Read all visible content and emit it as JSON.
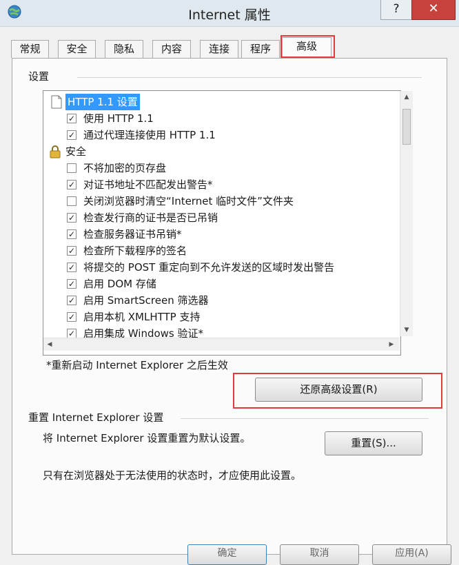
{
  "window": {
    "title": "Internet 属性",
    "help_label": "?",
    "close_label": "✕",
    "icon": "internet-options-globe-icon"
  },
  "tabs": [
    {
      "label": "常规"
    },
    {
      "label": "安全"
    },
    {
      "label": "隐私"
    },
    {
      "label": "内容"
    },
    {
      "label": "连接"
    },
    {
      "label": "程序"
    },
    {
      "label": "高级",
      "active": true
    }
  ],
  "settings_section": {
    "label": "设置",
    "rows": [
      {
        "type": "group",
        "icon": "page-icon",
        "label": "HTTP 1.1 设置",
        "selected": true
      },
      {
        "type": "checkbox",
        "checked": true,
        "label": "使用 HTTP 1.1"
      },
      {
        "type": "checkbox",
        "checked": true,
        "label": "通过代理连接使用 HTTP 1.1"
      },
      {
        "type": "group",
        "icon": "lock-icon",
        "label": "安全"
      },
      {
        "type": "checkbox",
        "checked": false,
        "label": "不将加密的页存盘"
      },
      {
        "type": "checkbox",
        "checked": true,
        "label": "对证书地址不匹配发出警告*"
      },
      {
        "type": "checkbox",
        "checked": false,
        "label": "关闭浏览器时清空“Internet 临时文件”文件夹"
      },
      {
        "type": "checkbox",
        "checked": true,
        "label": "检查发行商的证书是否已吊销"
      },
      {
        "type": "checkbox",
        "checked": true,
        "label": "检查服务器证书吊销*"
      },
      {
        "type": "checkbox",
        "checked": true,
        "label": "检查所下载程序的签名"
      },
      {
        "type": "checkbox",
        "checked": true,
        "label": "将提交的 POST 重定向到不允许发送的区域时发出警告"
      },
      {
        "type": "checkbox",
        "checked": true,
        "label": "启用 DOM 存储"
      },
      {
        "type": "checkbox",
        "checked": true,
        "label": "启用 SmartScreen 筛选器"
      },
      {
        "type": "checkbox",
        "checked": true,
        "label": "启用本机 XMLHTTP 支持"
      },
      {
        "type": "checkbox",
        "checked": true,
        "label": "启用集成 Windows 验证*"
      }
    ],
    "restart_note": "*重新启动 Internet Explorer 之后生效",
    "restore_button": "还原高级设置(R)"
  },
  "reset_section": {
    "label": "重置 Internet Explorer 设置",
    "description": "将 Internet Explorer 设置重置为默认设置。",
    "reset_button": "重置(S)...",
    "warning": "只有在浏览器处于无法使用的状态时，才应使用此设置。"
  },
  "dialog_buttons": {
    "ok": "确定",
    "cancel": "取消",
    "apply": "应用(A)"
  }
}
